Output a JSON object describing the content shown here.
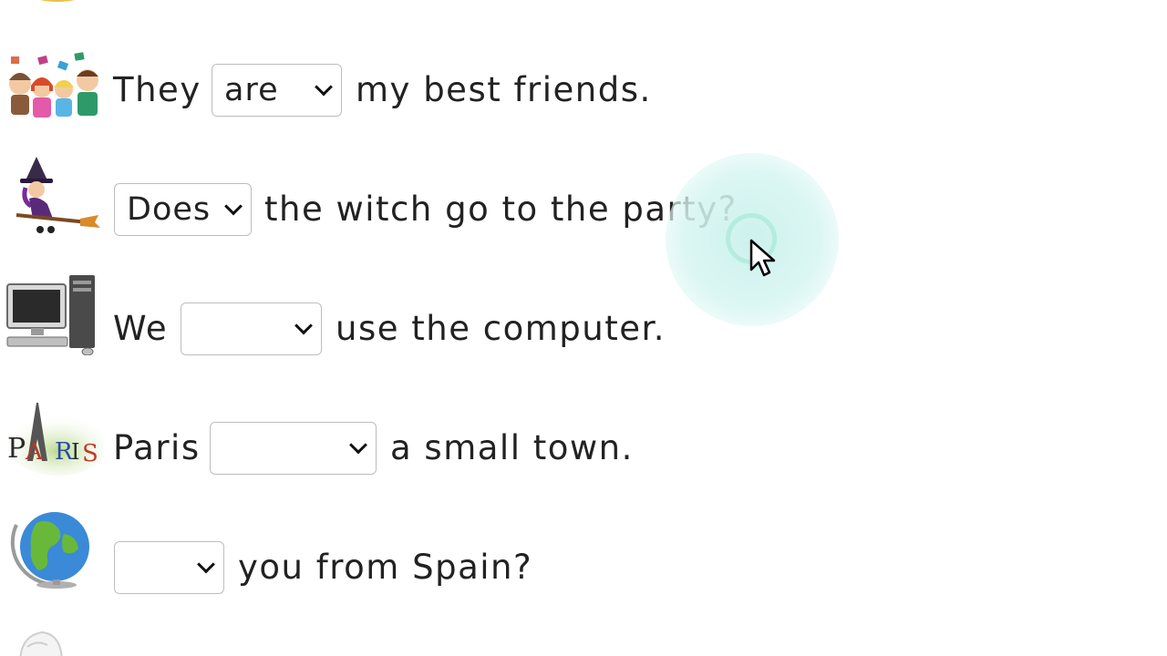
{
  "exercise": {
    "rows": [
      {
        "before": "They",
        "selected": "are",
        "after": "my best friends.",
        "picture": "friends-group-image"
      },
      {
        "before": "",
        "selected": "Does",
        "after": "the witch go to the party?",
        "picture": "witch-on-broom-image"
      },
      {
        "before": "We",
        "selected": "",
        "after": "use the computer.",
        "picture": "desktop-computer-image"
      },
      {
        "before": "Paris",
        "selected": "",
        "after": "a small town.",
        "picture": "paris-eiffel-tower-image"
      },
      {
        "before": "",
        "selected": "",
        "after": "you from Spain?",
        "picture": "globe-image"
      }
    ]
  },
  "colors": {
    "select_border": "#bdbdbd",
    "text": "#222222",
    "cursor_highlight": "#c8f0ec"
  }
}
